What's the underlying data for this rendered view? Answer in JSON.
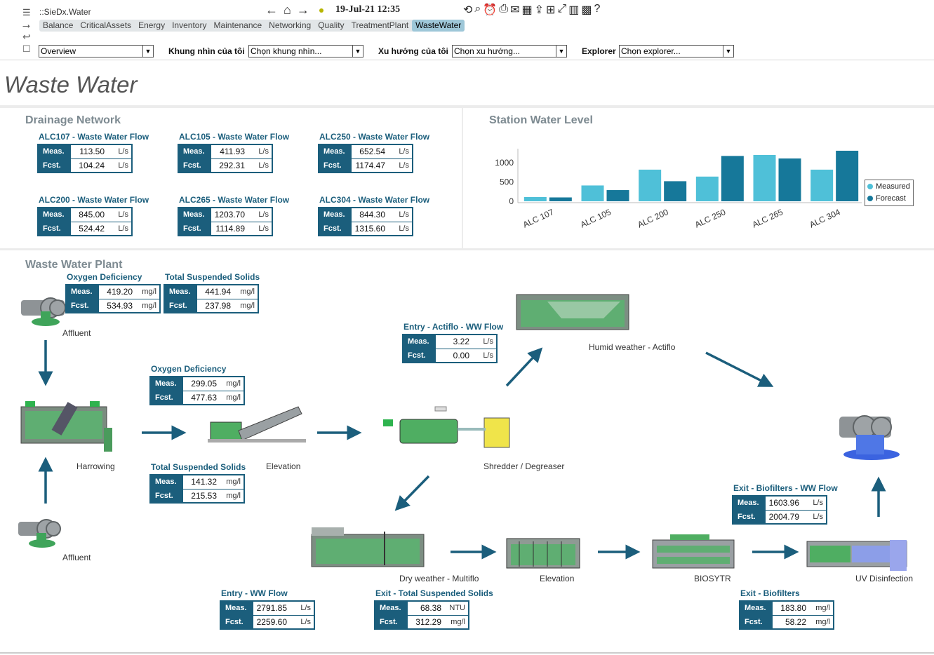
{
  "app": {
    "title": "::SieDx.Water",
    "datetime": "19-Jul-21 12:35"
  },
  "tabs": [
    "Balance",
    "CriticalAssets",
    "Energy",
    "Inventory",
    "Maintenance",
    "Networking",
    "Quality",
    "TreatmentPlant",
    "WasteWater"
  ],
  "active_tab": "WasteWater",
  "filters": {
    "overview_value": "Overview",
    "view_label": "Khung nhìn của tôi",
    "view_value": "Chọn khung nhìn...",
    "trend_label": "Xu hướng của tôi",
    "trend_value": "Chọn xu hướng...",
    "explorer_label": "Explorer",
    "explorer_value": "Chọn explorer..."
  },
  "page_title": "Waste Water",
  "drainage": {
    "title": "Drainage Network",
    "flows": [
      {
        "name": "ALC107 - Waste Water Flow",
        "meas": "113.50",
        "fcst": "104.24",
        "unit": "L/s"
      },
      {
        "name": "ALC105 - Waste Water Flow",
        "meas": "411.93",
        "fcst": "292.31",
        "unit": "L/s"
      },
      {
        "name": "ALC250 - Waste Water Flow",
        "meas": "652.54",
        "fcst": "1174.47",
        "unit": "L/s"
      },
      {
        "name": "ALC200 - Waste Water Flow",
        "meas": "845.00",
        "fcst": "524.42",
        "unit": "L/s"
      },
      {
        "name": "ALC265 - Waste Water Flow",
        "meas": "1203.70",
        "fcst": "1114.89",
        "unit": "L/s"
      },
      {
        "name": "ALC304 - Waste Water Flow",
        "meas": "844.30",
        "fcst": "1315.60",
        "unit": "L/s"
      }
    ]
  },
  "labels": {
    "meas": "Meas.",
    "fcst": "Fcst."
  },
  "chart_data": {
    "type": "bar",
    "title": "Station Water Level",
    "categories": [
      "ALC 107",
      "ALC 105",
      "ALC 200",
      "ALC 250",
      "ALC 265",
      "ALC 304"
    ],
    "series": [
      {
        "name": "Measured",
        "values": [
          110,
          410,
          820,
          640,
          1200,
          820
        ],
        "color": "#4fc0d8"
      },
      {
        "name": "Forecast",
        "values": [
          100,
          290,
          520,
          1175,
          1110,
          1310
        ],
        "color": "#16789a"
      }
    ],
    "yticks": [
      0,
      500,
      1000
    ],
    "ylim": [
      0,
      1400
    ],
    "legend": "right"
  },
  "plant": {
    "title": "Waste Water Plant",
    "metrics": [
      {
        "title": "Oxygen Deficiency",
        "meas": "419.20",
        "fcst": "534.93",
        "unit": "mg/l"
      },
      {
        "title": "Total Suspended Solids",
        "meas": "441.94",
        "fcst": "237.98",
        "unit": "mg/l"
      },
      {
        "title": "Oxygen Deficiency",
        "meas": "299.05",
        "fcst": "477.63",
        "unit": "mg/l"
      },
      {
        "title": "Total Suspended Solids",
        "meas": "141.32",
        "fcst": "215.53",
        "unit": "mg/l"
      },
      {
        "title": "Entry - Actiflo - WW Flow",
        "meas": "3.22",
        "fcst": "0.00",
        "unit": "L/s"
      },
      {
        "title": "Exit - Biofilters - WW Flow",
        "meas": "1603.96",
        "fcst": "2004.79",
        "unit": "L/s"
      },
      {
        "title": "Entry - WW Flow",
        "meas": "2791.85",
        "fcst": "2259.60",
        "unit": "L/s"
      },
      {
        "title": "Exit - Total Suspended Solids",
        "meas": "68.38",
        "fcst": "312.29",
        "unit_meas": "NTU",
        "unit_fcst": "mg/l"
      },
      {
        "title": "Exit - Biofilters",
        "meas": "183.80",
        "fcst": "58.22",
        "unit": "mg/l"
      }
    ],
    "captions": {
      "affluent_top": "Affluent",
      "affluent_bottom": "Affluent",
      "harrowing": "Harrowing",
      "elevation_1": "Elevation",
      "shredder": "Shredder / Degreaser",
      "actiflo": "Humid weather - Actiflo",
      "multiflo": "Dry weather - Multiflo",
      "elevation_2": "Elevation",
      "biosytr": "BIOSYTR",
      "uv": "UV Disinfection"
    }
  },
  "colors": {
    "accent": "#1b5e7c",
    "tab_active": "#9ec7d8",
    "equipment": "#3fa45a"
  }
}
